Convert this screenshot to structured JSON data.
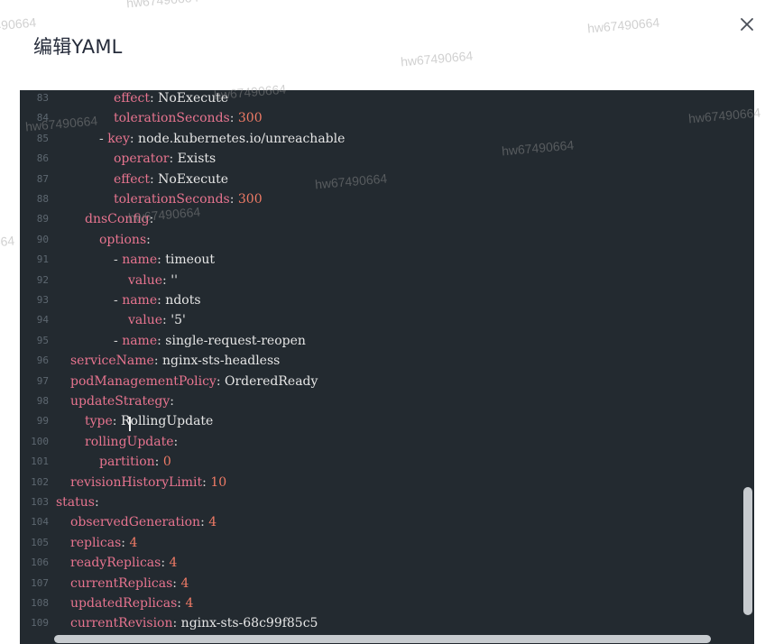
{
  "dialog": {
    "title": "编辑YAML",
    "close_label": "×"
  },
  "watermark": "hw67490664",
  "editor": {
    "lines": [
      {
        "n": "83",
        "indent": 4,
        "dash": false,
        "key": "effect",
        "value": "NoExecute",
        "vtype": "str"
      },
      {
        "n": "84",
        "indent": 4,
        "dash": false,
        "key": "tolerationSeconds",
        "value": "300",
        "vtype": "num"
      },
      {
        "n": "85",
        "indent": 3,
        "dash": true,
        "key": "key",
        "value": "node.kubernetes.io/unreachable",
        "vtype": "str"
      },
      {
        "n": "86",
        "indent": 4,
        "dash": false,
        "key": "operator",
        "value": "Exists",
        "vtype": "str"
      },
      {
        "n": "87",
        "indent": 4,
        "dash": false,
        "key": "effect",
        "value": "NoExecute",
        "vtype": "str"
      },
      {
        "n": "88",
        "indent": 4,
        "dash": false,
        "key": "tolerationSeconds",
        "value": "300",
        "vtype": "num"
      },
      {
        "n": "89",
        "indent": 2,
        "dash": false,
        "key": "dnsConfig",
        "value": "",
        "vtype": "str"
      },
      {
        "n": "90",
        "indent": 3,
        "dash": false,
        "key": "options",
        "value": "",
        "vtype": "str"
      },
      {
        "n": "91",
        "indent": 4,
        "dash": true,
        "key": "name",
        "value": "timeout",
        "vtype": "str"
      },
      {
        "n": "92",
        "indent": 5,
        "dash": false,
        "key": "value",
        "value": "''",
        "vtype": "str"
      },
      {
        "n": "93",
        "indent": 4,
        "dash": true,
        "key": "name",
        "value": "ndots",
        "vtype": "str"
      },
      {
        "n": "94",
        "indent": 5,
        "dash": false,
        "key": "value",
        "value": "'5'",
        "vtype": "str"
      },
      {
        "n": "95",
        "indent": 4,
        "dash": true,
        "key": "name",
        "value": "single-request-reopen",
        "vtype": "str"
      },
      {
        "n": "96",
        "indent": 1,
        "dash": false,
        "key": "serviceName",
        "value": "nginx-sts-headless",
        "vtype": "str"
      },
      {
        "n": "97",
        "indent": 1,
        "dash": false,
        "key": "podManagementPolicy",
        "value": "OrderedReady",
        "vtype": "str"
      },
      {
        "n": "98",
        "indent": 1,
        "dash": false,
        "key": "updateStrategy",
        "value": "",
        "vtype": "str"
      },
      {
        "n": "99",
        "indent": 2,
        "dash": false,
        "key": "type",
        "value": "RollingUpdate",
        "vtype": "str"
      },
      {
        "n": "100",
        "indent": 2,
        "dash": false,
        "key": "rollingUpdate",
        "value": "",
        "vtype": "str"
      },
      {
        "n": "101",
        "indent": 3,
        "dash": false,
        "key": "partition",
        "value": "0",
        "vtype": "num"
      },
      {
        "n": "102",
        "indent": 1,
        "dash": false,
        "key": "revisionHistoryLimit",
        "value": "10",
        "vtype": "num"
      },
      {
        "n": "103",
        "indent": 0,
        "dash": false,
        "key": "status",
        "value": "",
        "vtype": "str"
      },
      {
        "n": "104",
        "indent": 1,
        "dash": false,
        "key": "observedGeneration",
        "value": "4",
        "vtype": "num"
      },
      {
        "n": "105",
        "indent": 1,
        "dash": false,
        "key": "replicas",
        "value": "4",
        "vtype": "num"
      },
      {
        "n": "106",
        "indent": 1,
        "dash": false,
        "key": "readyReplicas",
        "value": "4",
        "vtype": "num"
      },
      {
        "n": "107",
        "indent": 1,
        "dash": false,
        "key": "currentReplicas",
        "value": "4",
        "vtype": "num"
      },
      {
        "n": "108",
        "indent": 1,
        "dash": false,
        "key": "updatedReplicas",
        "value": "4",
        "vtype": "num"
      },
      {
        "n": "109",
        "indent": 1,
        "dash": false,
        "key": "currentRevision",
        "value": "nginx-sts-68c99f85c5",
        "vtype": "str"
      }
    ]
  },
  "colors": {
    "editor_bg": "#232a30",
    "key": "#e7748f",
    "number": "#f07b66",
    "string": "#e6e6e6",
    "gutter": "#5d6770"
  }
}
